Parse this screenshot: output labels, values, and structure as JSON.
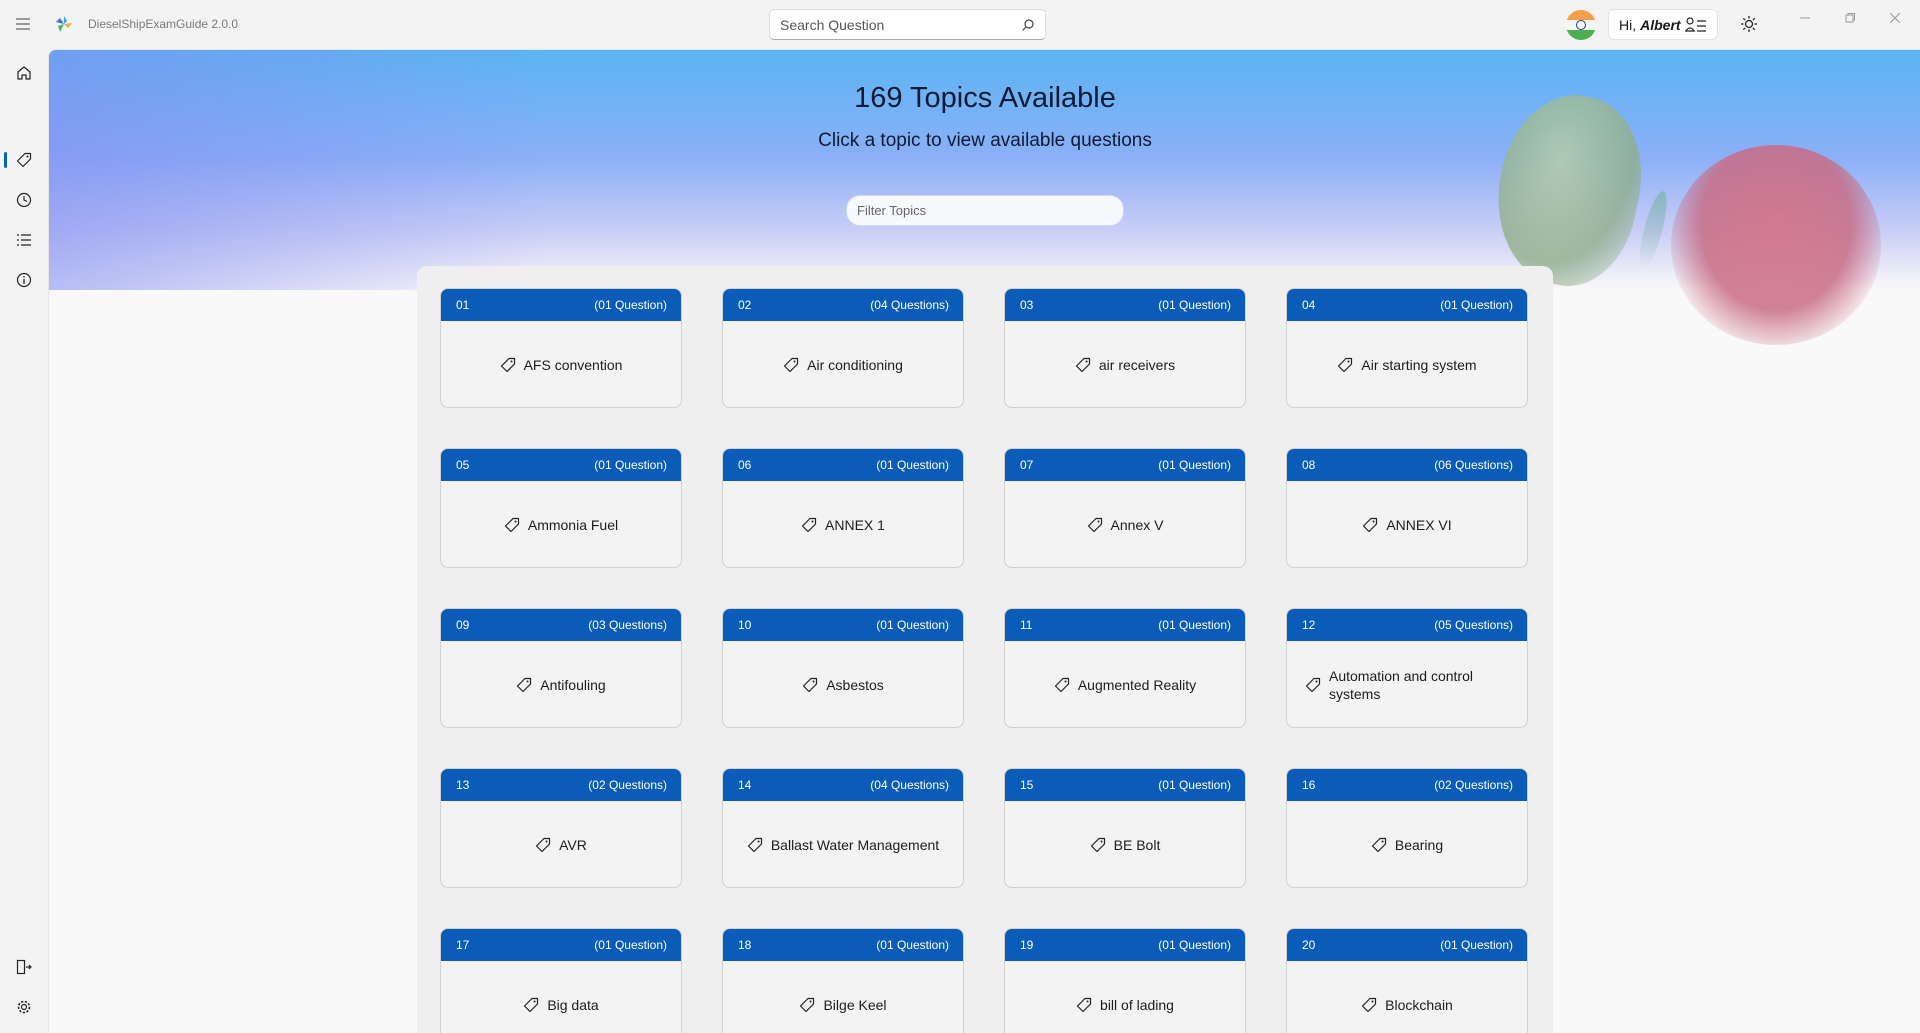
{
  "app": {
    "title": "DieselShipExamGuide 2.0.0"
  },
  "header": {
    "search_placeholder": "Search Question",
    "greeting": "Hi,",
    "user_name": "Albert"
  },
  "hero": {
    "title": "169 Topics Available",
    "subtitle": "Click a topic to view available questions",
    "filter_placeholder": "Filter Topics"
  },
  "nav": {
    "items": [
      "home-icon",
      "tag-icon",
      "history-icon",
      "list-icon",
      "info-icon"
    ],
    "active": "tag-icon",
    "footer": [
      "sign-out-icon",
      "settings-icon"
    ]
  },
  "topics": [
    {
      "num": "01",
      "count": "(01 Question)",
      "name": "AFS convention"
    },
    {
      "num": "02",
      "count": "(04 Questions)",
      "name": "Air conditioning"
    },
    {
      "num": "03",
      "count": "(01 Question)",
      "name": "air receivers"
    },
    {
      "num": "04",
      "count": "(01 Question)",
      "name": "Air starting system"
    },
    {
      "num": "05",
      "count": "(01 Question)",
      "name": "Ammonia Fuel"
    },
    {
      "num": "06",
      "count": "(01 Question)",
      "name": "ANNEX 1"
    },
    {
      "num": "07",
      "count": "(01 Question)",
      "name": "Annex V"
    },
    {
      "num": "08",
      "count": "(06 Questions)",
      "name": "ANNEX VI"
    },
    {
      "num": "09",
      "count": "(03 Questions)",
      "name": "Antifouling"
    },
    {
      "num": "10",
      "count": "(01 Question)",
      "name": "Asbestos"
    },
    {
      "num": "11",
      "count": "(01 Question)",
      "name": "Augmented Reality"
    },
    {
      "num": "12",
      "count": "(05 Questions)",
      "name": "Automation and control systems"
    },
    {
      "num": "13",
      "count": "(02 Questions)",
      "name": "AVR"
    },
    {
      "num": "14",
      "count": "(04 Questions)",
      "name": "Ballast Water Management"
    },
    {
      "num": "15",
      "count": "(01 Question)",
      "name": "BE Bolt"
    },
    {
      "num": "16",
      "count": "(02 Questions)",
      "name": "Bearing"
    },
    {
      "num": "17",
      "count": "(01 Question)",
      "name": "Big data"
    },
    {
      "num": "18",
      "count": "(01 Question)",
      "name": "Bilge Keel"
    },
    {
      "num": "19",
      "count": "(01 Question)",
      "name": "bill of lading"
    },
    {
      "num": "20",
      "count": "(01 Question)",
      "name": "Blockchain"
    }
  ],
  "colors": {
    "card_header": "#0a5cb8",
    "accent": "#0067c0"
  }
}
